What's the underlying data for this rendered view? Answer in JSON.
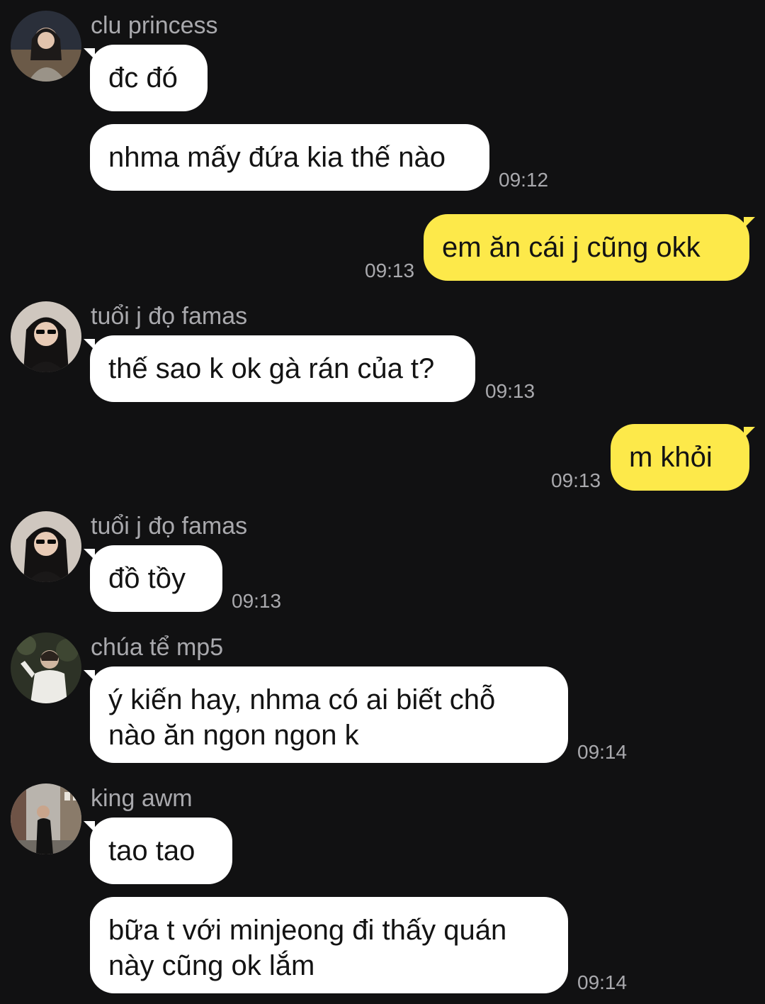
{
  "colors": {
    "background": "#111112",
    "incoming_bubble": "#ffffff",
    "outgoing_bubble": "#fde94a",
    "meta_text": "#a9a9ad",
    "bubble_text": "#131313"
  },
  "messages": [
    {
      "sender": "clu princess",
      "avatar_icon": "user-avatar-icon",
      "bubbles": [
        "đc đó",
        "nhma mấy đứa kia thế nào"
      ],
      "time": "09:12"
    },
    {
      "outgoing": true,
      "bubbles": [
        "em ăn cái j cũng okk"
      ],
      "time": "09:13"
    },
    {
      "sender": "tuổi j đọ famas",
      "avatar_icon": "user-avatar-icon",
      "bubbles": [
        "thế sao k ok gà rán của t?"
      ],
      "time": "09:13"
    },
    {
      "outgoing": true,
      "bubbles": [
        "m khỏi"
      ],
      "time": "09:13"
    },
    {
      "sender": "tuổi j đọ famas",
      "avatar_icon": "user-avatar-icon",
      "bubbles": [
        "đồ tồy"
      ],
      "time": "09:13"
    },
    {
      "sender": "chúa tể mp5",
      "avatar_icon": "user-avatar-icon",
      "bubbles": [
        [
          "ý kiến hay, nhma có ai biết chỗ",
          "nào ăn ngon ngon k"
        ]
      ],
      "time": "09:14"
    },
    {
      "sender": "king awm",
      "avatar_icon": "user-avatar-icon",
      "bubbles": [
        "tao tao",
        [
          "bữa t với minjeong đi thấy quán",
          "này cũng ok lắm"
        ]
      ],
      "time": "09:14"
    }
  ]
}
